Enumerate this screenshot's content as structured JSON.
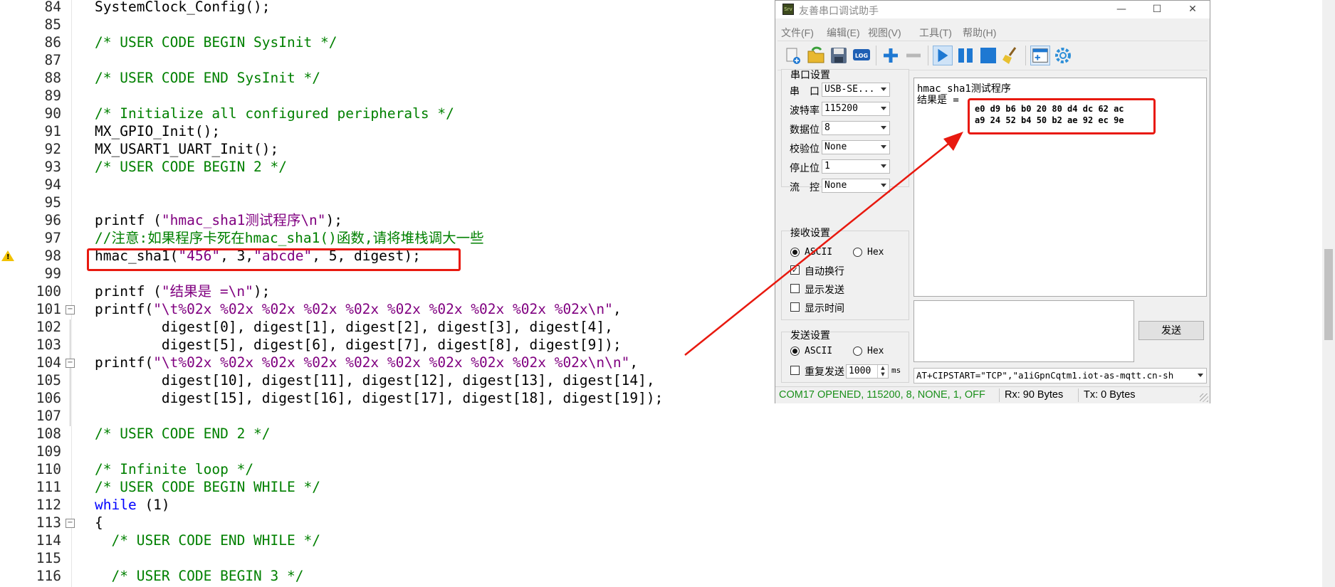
{
  "editor": {
    "line_numbers": [
      "84",
      "85",
      "86",
      "87",
      "88",
      "89",
      "90",
      "91",
      "92",
      "93",
      "94",
      "95",
      "96",
      "97",
      "98",
      "99",
      "100",
      "101",
      "102",
      "103",
      "104",
      "105",
      "106",
      "107",
      "108",
      "109",
      "110",
      "111",
      "112",
      "113",
      "114",
      "115",
      "116"
    ],
    "lines": {
      "l84": "SystemClock_Config();",
      "l86": "/* USER CODE BEGIN SysInit */",
      "l88": "/* USER CODE END SysInit */",
      "l90": "/* Initialize all configured peripherals */",
      "l91": "MX_GPIO_Init();",
      "l92": "MX_USART1_UART_Init();",
      "l93": "/* USER CODE BEGIN 2 */",
      "l96a": "printf (",
      "l96b": "\"hmac_sha1测试程序\\n\"",
      "l96c": ");",
      "l97": "//注意:如果程序卡死在hmac_sha1()函数,请将堆栈调大一些",
      "l98a": "hmac_sha1(",
      "l98b": "\"456\"",
      "l98c": ", 3,",
      "l98d": "\"abcde\"",
      "l98e": ", 5, digest);",
      "l100a": "printf (",
      "l100b": "\"结果是 =\\n\"",
      "l100c": ");",
      "l101a": "printf(",
      "l101b": "\"\\t%02x %02x %02x %02x %02x %02x %02x %02x %02x %02x\\n\"",
      "l101c": ",",
      "l102": "        digest[0], digest[1], digest[2], digest[3], digest[4],",
      "l103": "        digest[5], digest[6], digest[7], digest[8], digest[9]);",
      "l104a": "printf(",
      "l104b": "\"\\t%02x %02x %02x %02x %02x %02x %02x %02x %02x %02x\\n\\n\"",
      "l104c": ",",
      "l105": "        digest[10], digest[11], digest[12], digest[13], digest[14],",
      "l106": "        digest[15], digest[16], digest[17], digest[18], digest[19]);",
      "l108": "/* USER CODE END 2 */",
      "l110": "/* Infinite loop */",
      "l111": "/* USER CODE BEGIN WHILE */",
      "l112a": "while",
      "l112b": " (1)",
      "l113": "{",
      "l114": "  /* USER CODE END WHILE */",
      "l116": "  /* USER CODE BEGIN 3 */"
    }
  },
  "serial_window": {
    "title": "友善串口调试助手",
    "app_icon_text": "Srv",
    "controls": {
      "minimize": "—",
      "maximize": "☐",
      "close": "✕"
    },
    "menu": [
      "文件(F)",
      "编辑(E)",
      "视图(V)",
      "工具(T)",
      "帮助(H)"
    ],
    "toolbar_icons": [
      "new-session-icon",
      "open-folder-icon",
      "save-icon",
      "log-icon",
      "add-icon",
      "remove-icon",
      "play-icon",
      "pause-icon",
      "stop-icon",
      "clear-broom-icon",
      "layout-icon",
      "settings-gear-icon"
    ],
    "toolbar_log_text": "LOG",
    "serial_settings": {
      "title": "串口设置",
      "rows": [
        {
          "label": "串　口",
          "value": "USB-SE..."
        },
        {
          "label": "波特率",
          "value": "115200"
        },
        {
          "label": "数据位",
          "value": "8"
        },
        {
          "label": "校验位",
          "value": "None"
        },
        {
          "label": "停止位",
          "value": "1"
        },
        {
          "label": "流　控",
          "value": "None"
        }
      ]
    },
    "receive_settings": {
      "title": "接收设置",
      "ascii": "ASCII",
      "hex": "Hex",
      "auto_wrap": "自动换行",
      "show_send": "显示发送",
      "show_time": "显示时间"
    },
    "send_settings": {
      "title": "发送设置",
      "ascii": "ASCII",
      "hex": "Hex",
      "repeat": "重复发送",
      "interval": "1000",
      "unit": "ms"
    },
    "receive_text": {
      "line1": "hmac_sha1测试程序",
      "line2": "结果是 =",
      "line3": "e0 d9 b6 b0 20 80 d4 dc 62 ac",
      "line4": "a9 24 52 b4 50 b2 ae 92 ec 9e"
    },
    "send_button": "发送",
    "command_value": "AT+CIPSTART=\"TCP\",\"a1iGpnCqtm1.iot-as-mqtt.cn-sh",
    "status": {
      "port": "COM17 OPENED, 115200, 8, NONE, 1, OFF",
      "rx": "Rx: 90 Bytes",
      "tx": "Tx: 0 Bytes"
    },
    "colors": {
      "status_green": "#1a8f1a",
      "annotation_red": "#e8190f"
    }
  }
}
